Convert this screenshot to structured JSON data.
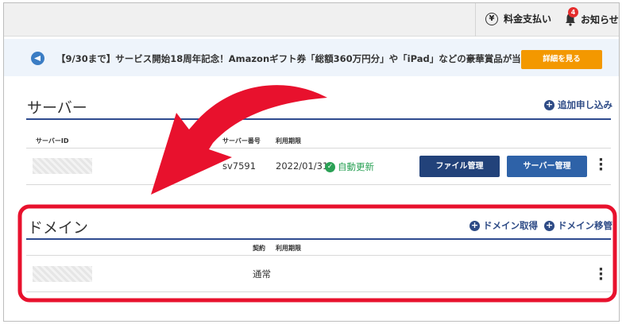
{
  "topbar": {
    "payment_label": "料金支払い",
    "yen_glyph": "¥",
    "notice_label": "お知らせ",
    "notice_count": "4"
  },
  "banner": {
    "text": "【9/30まで】サービス開始18周年記念！Amazonギフト券「総額360万円分」や「iPad」などの豪華賞品が当たるチャンス",
    "button_label": "詳細を見る"
  },
  "server": {
    "title": "サーバー",
    "add_label": "追加申し込み",
    "columns": {
      "id": "サーバーID",
      "number": "サーバー番号",
      "period": "利用期限"
    },
    "row": {
      "number": "sv7591",
      "period": "2022/01/31",
      "status": "自動更新",
      "file_button": "ファイル管理",
      "server_button": "サーバー管理"
    }
  },
  "domain": {
    "title": "ドメイン",
    "acquire_label": "ドメイン取得",
    "transfer_label": "ドメイン移管",
    "columns": {
      "contract": "契約",
      "period": "利用期限"
    },
    "row": {
      "contract": "通常"
    }
  },
  "colors": {
    "accent_navy": "#2f4b8f",
    "orange": "#f39800",
    "green": "#2aa155",
    "annotation_red": "#e8112d"
  }
}
